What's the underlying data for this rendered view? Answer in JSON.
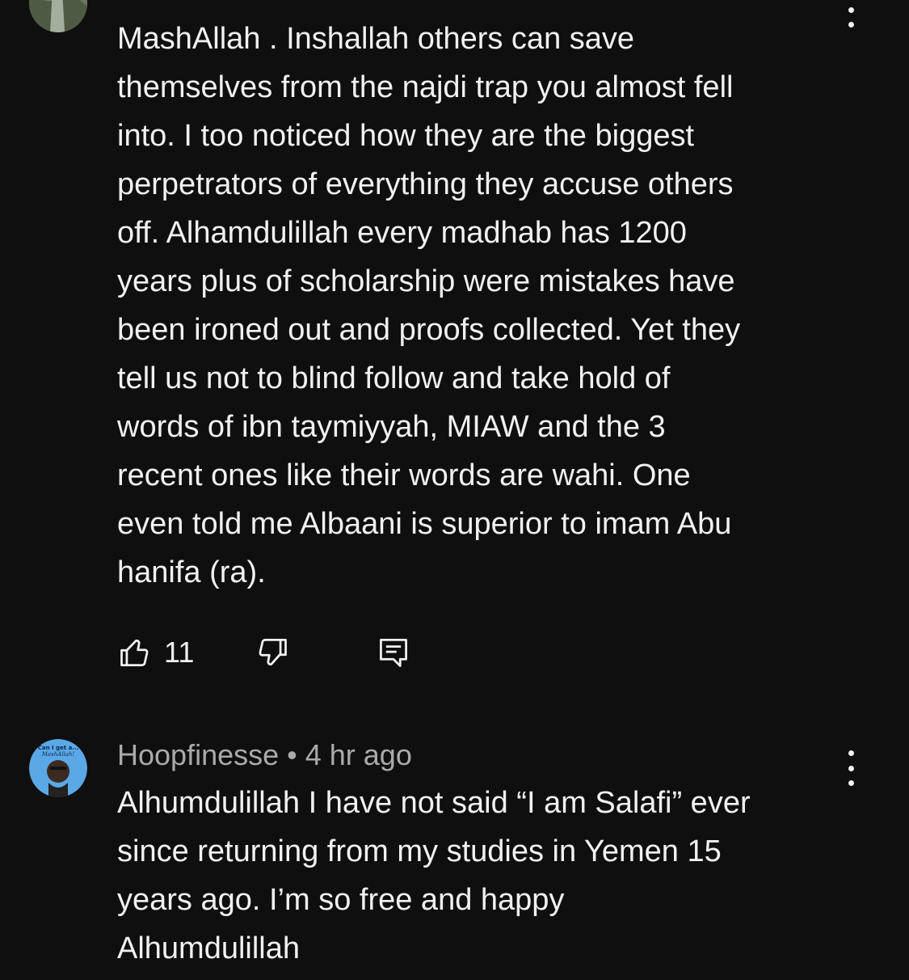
{
  "comments": [
    {
      "author": "",
      "time": "",
      "lines": [
        "MashAllah . Inshallah others can save",
        "themselves from the najdi trap you almost fell",
        "into.  I too noticed how they are the biggest",
        "perpetrators of everything they accuse others",
        "off.  Alhamdulillah every madhab has 1200",
        "years plus of scholarship were mistakes have",
        "been ironed out and proofs collected. Yet they",
        "tell us not to blind follow and take hold of",
        "words of ibn taymiyyah, MIAW and the 3",
        "recent ones like their words are wahi.  One",
        "even told me Albaani is superior to imam Abu",
        "hanifa (ra)."
      ],
      "likes": "11"
    },
    {
      "author": "Hoopfinesse",
      "separator": "•",
      "time": "4 hr ago",
      "lines": [
        "Alhumdulillah I have not said “I am Salafi” ever",
        "since returning from my studies in Yemen 15",
        "years ago. I’m so free and happy",
        "Alhumdulillah"
      ],
      "avatar_text": "Can I get a... MashAllah!"
    }
  ],
  "icons": {
    "like": "thumbs-up-icon",
    "dislike": "thumbs-down-icon",
    "reply": "reply-icon",
    "menu": "more-vert-icon"
  },
  "colors": {
    "background": "#0f0f0f",
    "text": "#f1f1f1",
    "meta": "#aaaaaa",
    "avatar_blue": "#5aa9e6"
  }
}
